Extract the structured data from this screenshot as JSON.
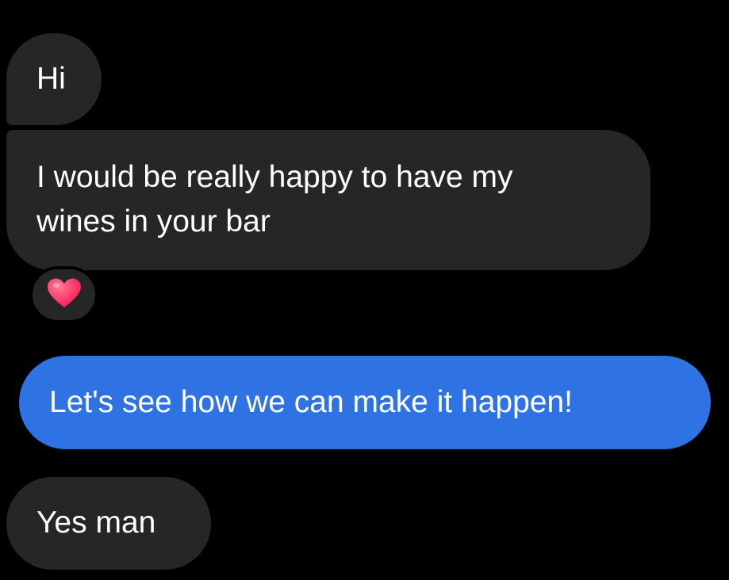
{
  "conversation": {
    "messages": [
      {
        "sender": "them",
        "text": "Hi"
      },
      {
        "sender": "them",
        "text_lines": [
          "I would be really happy to have my",
          "wines in your bar"
        ],
        "reaction": "heart"
      },
      {
        "sender": "me",
        "text": "Let's see how we can make it happen!"
      },
      {
        "sender": "them",
        "text": "Yes man"
      }
    ]
  },
  "colors": {
    "background": "#000000",
    "incoming_bubble": "#262626",
    "outgoing_bubble": "#2e72e4",
    "text": "#ffffff",
    "reaction_heart": "#ff3c6e"
  },
  "icons": {
    "reaction": "heart-icon"
  }
}
